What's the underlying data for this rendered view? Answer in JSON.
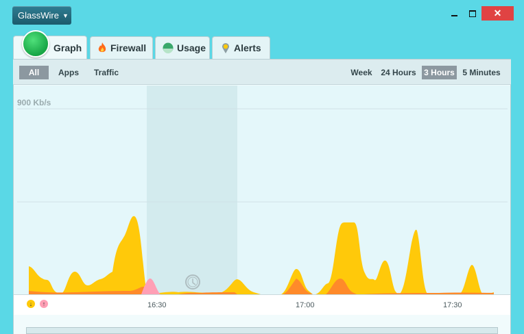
{
  "app": {
    "menu_label": "GlassWire"
  },
  "window": {
    "close_glyph": "✕"
  },
  "tabs": [
    {
      "label": "Graph",
      "icon": "globe-icon"
    },
    {
      "label": "Firewall",
      "icon": "fire-icon"
    },
    {
      "label": "Usage",
      "icon": "usage-icon"
    },
    {
      "label": "Alerts",
      "icon": "alert-pin-icon"
    }
  ],
  "filters": {
    "all": "All",
    "apps": "Apps",
    "traffic": "Traffic"
  },
  "ranges": {
    "week": "Week",
    "h24": "24 Hours",
    "h3": "3 Hours",
    "m5": "5 Minutes",
    "selected": "3 Hours"
  },
  "graph": {
    "scale_label": "900 Kb/s",
    "time_labels": [
      "16:30",
      "17:00",
      "17:30"
    ],
    "legend": {
      "download": "↓",
      "upload": "↑"
    },
    "colors": {
      "incoming": "#ffc90a",
      "outgoing": "#ff8a2a",
      "highlight": "#ff9fb5",
      "background": "#e4f7fa"
    }
  }
}
